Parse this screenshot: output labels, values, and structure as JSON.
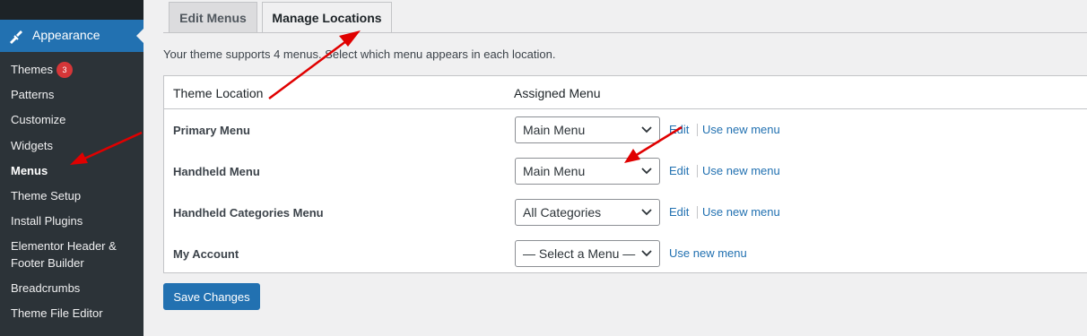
{
  "sidebar": {
    "section_label": "Appearance",
    "items": [
      {
        "label": "Themes",
        "badge": "3"
      },
      {
        "label": "Patterns"
      },
      {
        "label": "Customize"
      },
      {
        "label": "Widgets"
      },
      {
        "label": "Menus",
        "current": true
      },
      {
        "label": "Theme Setup"
      },
      {
        "label": "Install Plugins"
      },
      {
        "label": "Elementor Header &"
      },
      {
        "label": "Footer Builder"
      },
      {
        "label": "Breadcrumbs"
      },
      {
        "label": "Theme File Editor"
      }
    ]
  },
  "tabs": [
    {
      "label": "Edit Menus",
      "active": false
    },
    {
      "label": "Manage Locations",
      "active": true
    }
  ],
  "intro": "Your theme supports 4 menus. Select which menu appears in each location.",
  "table": {
    "headers": [
      "Theme Location",
      "Assigned Menu"
    ],
    "rows": [
      {
        "location": "Primary Menu",
        "menu": "Main Menu",
        "edit": "Edit",
        "use_new": "Use new menu"
      },
      {
        "location": "Handheld Menu",
        "menu": "Main Menu",
        "edit": "Edit",
        "use_new": "Use new menu"
      },
      {
        "location": "Handheld Categories Menu",
        "menu": "All Categories",
        "edit": "Edit",
        "use_new": "Use new menu"
      },
      {
        "location": "My Account",
        "menu": "— Select a Menu —",
        "use_new": "Use new menu"
      }
    ]
  },
  "save_label": "Save Changes",
  "colors": {
    "sidebar_bg": "#1d2327",
    "submenu_bg": "#2c3338",
    "accent": "#2271b1",
    "badge": "#d63638",
    "annotation_arrow": "#e00000"
  }
}
